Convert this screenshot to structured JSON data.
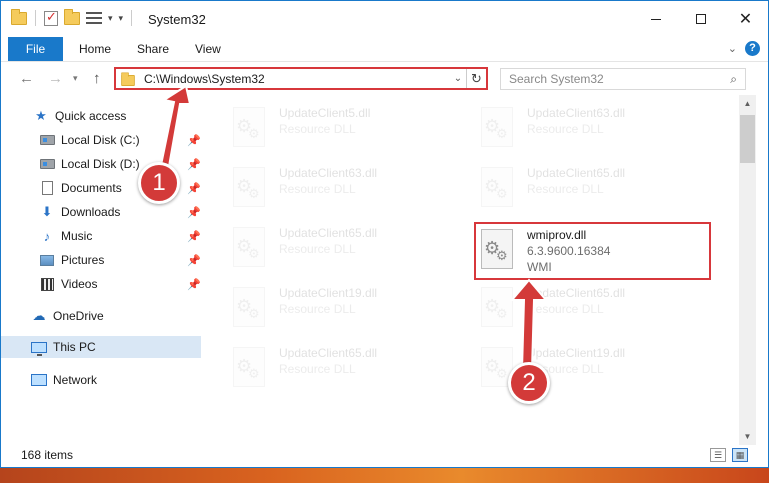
{
  "window": {
    "title": "System32",
    "controls": {
      "minimize": "minimize-icon",
      "maximize": "maximize-icon",
      "close": "✕"
    }
  },
  "ribbon": {
    "tabs": [
      {
        "label": "File"
      },
      {
        "label": "Home"
      },
      {
        "label": "Share"
      },
      {
        "label": "View"
      }
    ],
    "help": "?"
  },
  "address": {
    "path": "C:\\Windows\\System32",
    "search_placeholder": "Search System32"
  },
  "sidebar": {
    "items": [
      {
        "label": "Quick access",
        "icon": "star-icon",
        "pinned": false
      },
      {
        "label": "Local Disk (C:)",
        "icon": "drive-icon",
        "pinned": true
      },
      {
        "label": "Local Disk (D:)",
        "icon": "drive-icon",
        "pinned": true
      },
      {
        "label": "Documents",
        "icon": "documents-icon",
        "pinned": true
      },
      {
        "label": "Downloads",
        "icon": "downloads-icon",
        "pinned": true
      },
      {
        "label": "Music",
        "icon": "music-icon",
        "pinned": true
      },
      {
        "label": "Pictures",
        "icon": "pictures-icon",
        "pinned": true
      },
      {
        "label": "Videos",
        "icon": "videos-icon",
        "pinned": true
      },
      {
        "label": "OneDrive",
        "icon": "onedrive-icon",
        "pinned": false
      },
      {
        "label": "This PC",
        "icon": "this-pc-icon",
        "pinned": false,
        "selected": true
      },
      {
        "label": "Network",
        "icon": "network-icon",
        "pinned": false
      }
    ]
  },
  "files": {
    "left_column": [
      {
        "name": "UpdateClient5.dll",
        "type": "Resource DLL"
      },
      {
        "name": "UpdateClient63.dll",
        "type": "Resource DLL"
      },
      {
        "name": "UpdateClient65.dll",
        "type": "Resource DLL"
      },
      {
        "name": "UpdateClient19.dll",
        "type": "Resource DLL"
      },
      {
        "name": "UpdateClient65.dll",
        "type": "Resource DLL"
      }
    ],
    "right_column": [
      {
        "name": "UpdateClient63.dll",
        "type": "Resource DLL"
      },
      {
        "name": "UpdateClient65.dll",
        "type": "Resource DLL"
      },
      {
        "name": "wmiprov.dll",
        "version": "6.3.9600.16384",
        "type": "WMI",
        "highlighted": true
      },
      {
        "name": "UpdateClient65.dll",
        "type": "Resource DLL"
      },
      {
        "name": "UpdateClient19.dll",
        "type": "Resource DLL"
      }
    ]
  },
  "status": {
    "item_count": "168 items"
  },
  "annotations": {
    "step1": "1",
    "step2": "2",
    "color": "#d33a39"
  }
}
